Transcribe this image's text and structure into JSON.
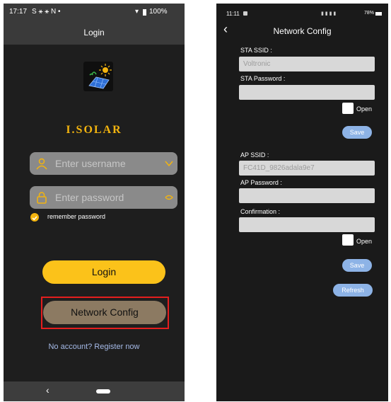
{
  "login_screen": {
    "status": {
      "time": "17:17",
      "icons_left": "S ⚹ ⚹ N •",
      "battery": "100%"
    },
    "title": "Login",
    "app_name": "I.SOLAR",
    "username_placeholder": "Enter username",
    "password_placeholder": "Enter password",
    "remember_label": "remember password",
    "remember_checked": true,
    "login_button": "Login",
    "network_config_button": "Network Config",
    "register_link": "No account? Register now",
    "nav_back_icon": "‹",
    "colors": {
      "accent": "#fbc21a",
      "highlight_box": "#e41e1e",
      "link": "#a6bbe8"
    }
  },
  "network_config": {
    "status": {
      "time": "11:11",
      "battery": "78%"
    },
    "back_icon": "‹",
    "title": "Network Config",
    "sta_ssid_label": "STA SSID :",
    "sta_ssid_value": "Voltronic",
    "sta_password_label": "STA Password :",
    "sta_password_value": "",
    "sta_open_label": "Open",
    "sta_save_button": "Save",
    "ap_ssid_label": "AP SSID :",
    "ap_ssid_value": "FC41D_9826adala9e7",
    "ap_password_label": "AP Password :",
    "ap_password_value": "",
    "confirmation_label": "Confirmation :",
    "confirmation_value": "",
    "ap_open_label": "Open",
    "ap_save_button": "Save",
    "refresh_button": "Refresh",
    "colors": {
      "pill_button": "#8db3e6",
      "field": "#d8d8d8"
    }
  }
}
